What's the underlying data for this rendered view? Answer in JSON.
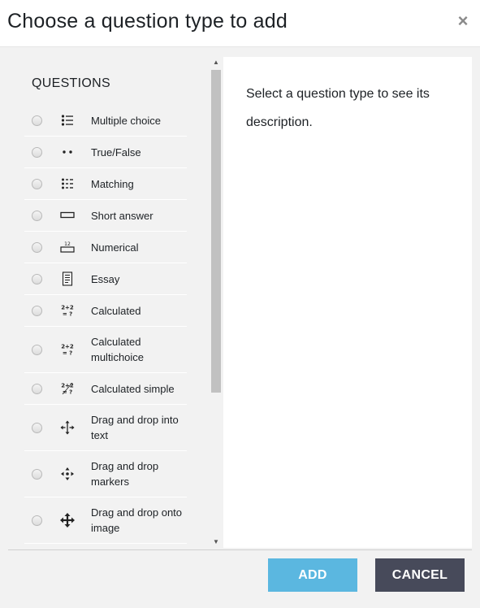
{
  "dialog": {
    "title": "Choose a question type to add",
    "close_icon": "×"
  },
  "list": {
    "section_title": "QUESTIONS",
    "items": [
      {
        "label": "Multiple choice",
        "icon": "multiple-choice-icon"
      },
      {
        "label": "True/False",
        "icon": "true-false-icon"
      },
      {
        "label": "Matching",
        "icon": "matching-icon"
      },
      {
        "label": "Short answer",
        "icon": "short-answer-icon"
      },
      {
        "label": "Numerical",
        "icon": "numerical-icon"
      },
      {
        "label": "Essay",
        "icon": "essay-icon"
      },
      {
        "label": "Calculated",
        "icon": "calculated-icon"
      },
      {
        "label": "Calculated multichoice",
        "icon": "calculated-multichoice-icon"
      },
      {
        "label": "Calculated simple",
        "icon": "calculated-simple-icon"
      },
      {
        "label": "Drag and drop into text",
        "icon": "drag-drop-text-icon"
      },
      {
        "label": "Drag and drop markers",
        "icon": "drag-drop-markers-icon"
      },
      {
        "label": "Drag and drop onto image",
        "icon": "drag-drop-image-icon"
      }
    ],
    "icon_texts": {
      "numerical": "12",
      "calc_top": "2+2",
      "calc_bottom": "= ?"
    }
  },
  "description": {
    "text": "Select a question type to see its description."
  },
  "footer": {
    "add_label": "ADD",
    "cancel_label": "CANCEL"
  },
  "colors": {
    "add_button": "#5bb7e0",
    "cancel_button": "#474a5a",
    "panel_bg": "#f2f2f2"
  }
}
